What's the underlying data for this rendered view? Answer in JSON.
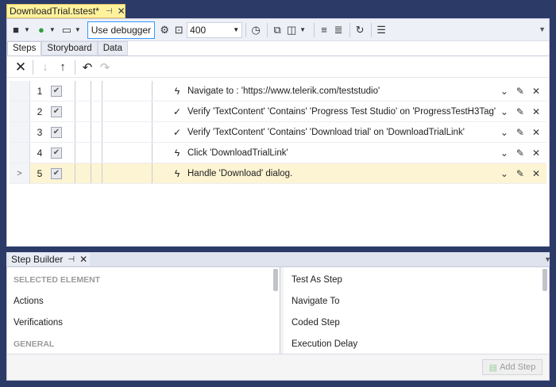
{
  "document": {
    "tab_title": "DownloadTrial.tstest*",
    "pin_icon": "pin-icon",
    "close_icon": "close-icon"
  },
  "toolbar": {
    "use_debugger_label": "Use debugger",
    "zoom_value": "400"
  },
  "subtabs": [
    "Steps",
    "Storyboard",
    "Data"
  ],
  "steps": [
    {
      "number": "1",
      "checked": true,
      "icon": "lightning-icon",
      "description": "Navigate to : 'https://www.telerik.com/teststudio'",
      "selected": false,
      "marker": ""
    },
    {
      "number": "2",
      "checked": true,
      "icon": "check-icon",
      "description": "Verify 'TextContent' 'Contains' 'Progress Test Studio' on 'ProgressTestH3Tag'",
      "selected": false,
      "marker": ""
    },
    {
      "number": "3",
      "checked": true,
      "icon": "check-icon",
      "description": "Verify 'TextContent' 'Contains' 'Download trial' on 'DownloadTrialLink'",
      "selected": false,
      "marker": ""
    },
    {
      "number": "4",
      "checked": true,
      "icon": "lightning-icon",
      "description": "Click 'DownloadTrialLink'",
      "selected": false,
      "marker": ""
    },
    {
      "number": "5",
      "checked": true,
      "icon": "lightning-icon",
      "description": "Handle 'Download' dialog.",
      "selected": true,
      "marker": ">"
    }
  ],
  "step_builder": {
    "title": "Step Builder",
    "left_items": [
      {
        "label": "SELECTED ELEMENT",
        "heading": true
      },
      {
        "label": "Actions",
        "heading": false
      },
      {
        "label": "Verifications",
        "heading": false
      },
      {
        "label": "GENERAL",
        "heading": true
      }
    ],
    "right_items": [
      {
        "label": "Test As Step"
      },
      {
        "label": "Navigate To"
      },
      {
        "label": "Coded Step"
      },
      {
        "label": "Execution Delay"
      }
    ],
    "add_step_label": "Add Step"
  },
  "colors": {
    "background": "#2b3a67",
    "active_tab": "#fff29d",
    "selected_row": "#fdf4d4",
    "debugger_border": "#3399ff"
  }
}
